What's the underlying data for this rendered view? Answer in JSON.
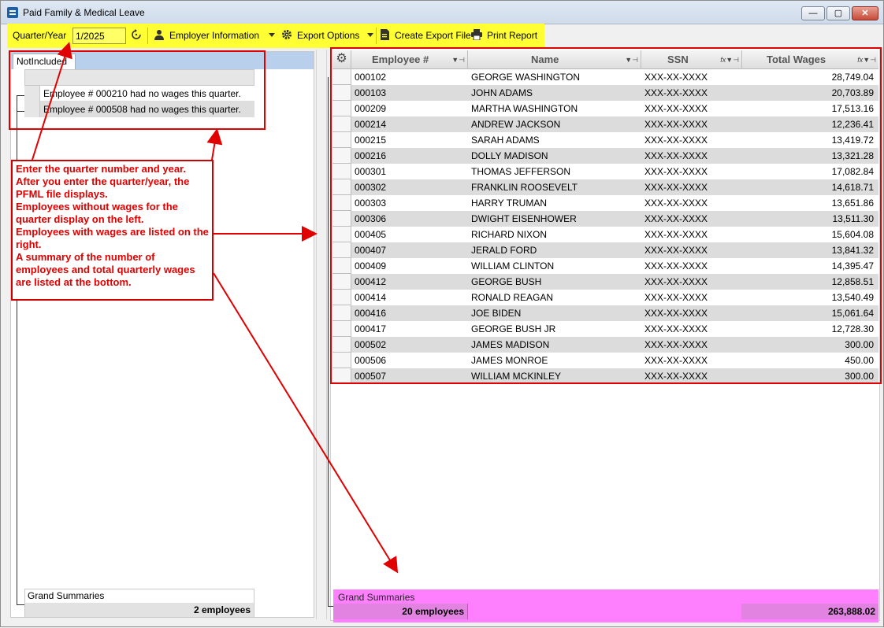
{
  "window": {
    "title": "Paid Family & Medical Leave",
    "controls": {
      "minimize": "—",
      "maximize": "▢",
      "close": "✕"
    }
  },
  "toolbar": {
    "quarter_label": "Quarter/Year",
    "quarter_value": "1/2025",
    "employer_info": "Employer Information",
    "export_options": "Export Options",
    "create_export": "Create Export File",
    "print_report": "Print Report",
    "icons": [
      "refresh-icon",
      "user-icon",
      "gear-icon",
      "export-file-icon",
      "printer-icon"
    ]
  },
  "left": {
    "tab": "NotIncluded",
    "rows": [
      "Employee # 000210 had no wages this quarter.",
      "Employee # 000508 had no wages this quarter."
    ],
    "grand_summaries": "Grand Summaries",
    "count": "2 employees"
  },
  "grid": {
    "columns": [
      "Employee #",
      "Name",
      "SSN",
      "Total Wages"
    ],
    "rows": [
      [
        "000102",
        "GEORGE   WASHINGTON",
        "XXX-XX-XXXX",
        "28,749.04"
      ],
      [
        "000103",
        "JOHN   ADAMS",
        "XXX-XX-XXXX",
        "20,703.89"
      ],
      [
        "000209",
        "MARTHA   WASHINGTON",
        "XXX-XX-XXXX",
        "17,513.16"
      ],
      [
        "000214",
        "ANDREW   JACKSON",
        "XXX-XX-XXXX",
        "12,236.41"
      ],
      [
        "000215",
        "SARAH   ADAMS",
        "XXX-XX-XXXX",
        "13,419.72"
      ],
      [
        "000216",
        "DOLLY   MADISON",
        "XXX-XX-XXXX",
        "13,321.28"
      ],
      [
        "000301",
        "THOMAS   JEFFERSON",
        "XXX-XX-XXXX",
        "17,082.84"
      ],
      [
        "000302",
        "FRANKLIN   ROOSEVELT",
        "XXX-XX-XXXX",
        "14,618.71"
      ],
      [
        "000303",
        "HARRY   TRUMAN",
        "XXX-XX-XXXX",
        "13,651.86"
      ],
      [
        "000306",
        "DWIGHT   EISENHOWER",
        "XXX-XX-XXXX",
        "13,511.30"
      ],
      [
        "000405",
        "RICHARD   NIXON",
        "XXX-XX-XXXX",
        "15,604.08"
      ],
      [
        "000407",
        "JERALD   FORD",
        "XXX-XX-XXXX",
        "13,841.32"
      ],
      [
        "000409",
        "WILLIAM   CLINTON",
        "XXX-XX-XXXX",
        "14,395.47"
      ],
      [
        "000412",
        "GEORGE   BUSH",
        "XXX-XX-XXXX",
        "12,858.51"
      ],
      [
        "000414",
        "RONALD   REAGAN",
        "XXX-XX-XXXX",
        "13,540.49"
      ],
      [
        "000416",
        "JOE   BIDEN",
        "XXX-XX-XXXX",
        "15,061.64"
      ],
      [
        "000417",
        "GEORGE   BUSH JR",
        "XXX-XX-XXXX",
        "12,728.30"
      ],
      [
        "000502",
        "JAMES   MADISON",
        "XXX-XX-XXXX",
        "300.00"
      ],
      [
        "000506",
        "JAMES   MONROE",
        "XXX-XX-XXXX",
        "450.00"
      ],
      [
        "000507",
        "WILLIAM   MCKINLEY",
        "XXX-XX-XXXX",
        "300.00"
      ]
    ],
    "grand_summaries": "Grand Summaries",
    "count": "20 employees",
    "total": "263,888.02"
  },
  "annotation": {
    "lines": [
      "Enter the quarter number and year.",
      "After you enter the quarter/year, the PFML file displays.",
      "Employees without wages for the quarter display on the left.",
      "Employees with wages are listed on the right.",
      "A summary of the number of employees and total quarterly wages are listed at the bottom."
    ]
  },
  "colors": {
    "toolbar_bg": "#ffff33",
    "annotation_red": "#e00000",
    "summary_pink": "#ff80ff"
  }
}
